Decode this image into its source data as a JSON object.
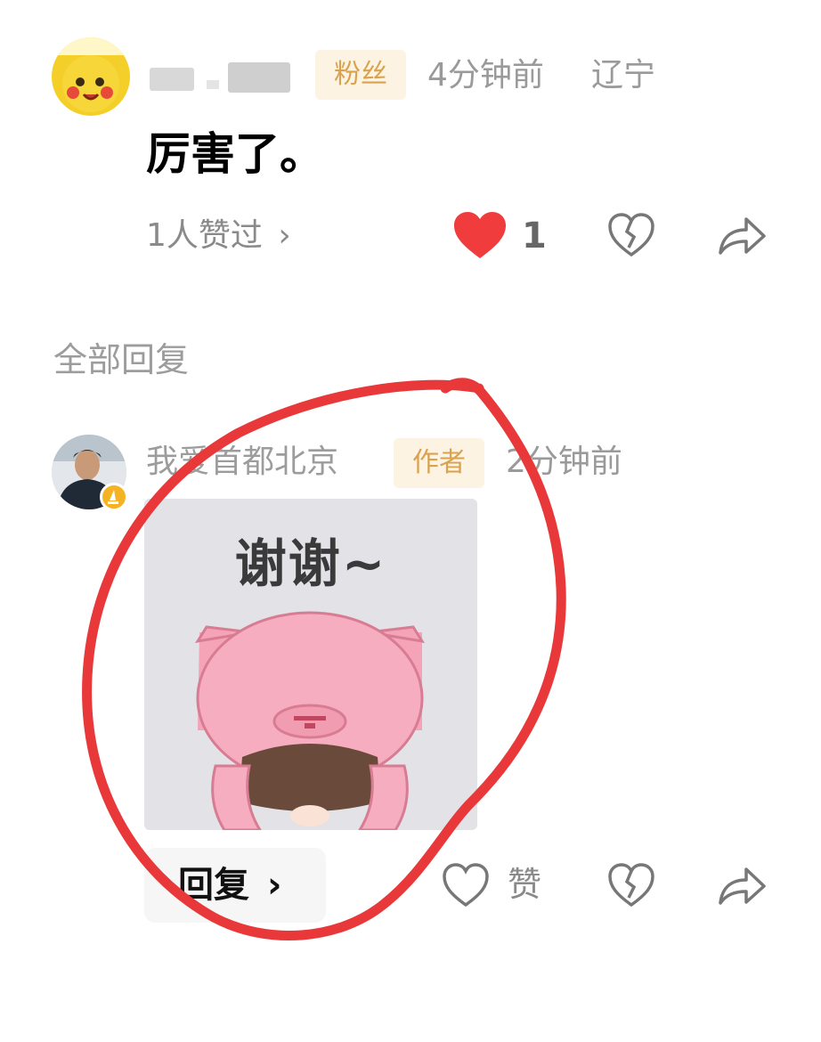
{
  "comment": {
    "author_name": "",
    "badge": "粉丝",
    "time": "4分钟前",
    "location": "辽宁",
    "text": "厉害了。",
    "liked_by": "1人赞过",
    "like_count": "1",
    "colors": {
      "like_heart": "#f03c3c",
      "badge_bg": "#fdf3e3",
      "badge_text": "#d9a24e"
    }
  },
  "replies_header": "全部回复",
  "reply": {
    "author_name": "我爱首都北京",
    "badge": "作者",
    "time": "2分钟前",
    "sticker_text": "谢谢~",
    "reply_button": "回复",
    "like_label": "赞",
    "icons": [
      "heart-outline-icon",
      "broken-heart-icon",
      "share-arrow-icon"
    ]
  },
  "annotation": {
    "color": "#e8383a"
  }
}
